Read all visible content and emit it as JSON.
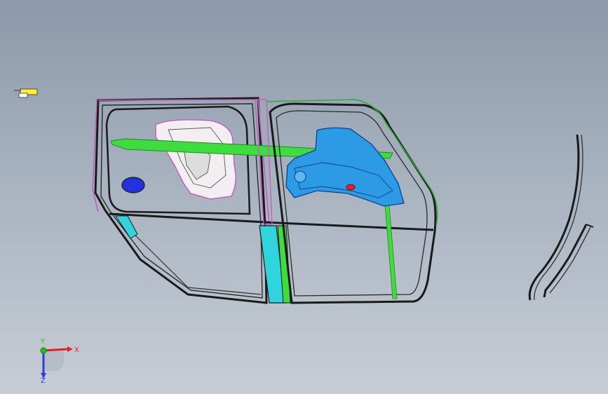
{
  "viewport": {
    "background_top": "#8c99aa",
    "background_bottom": "#c7cdd5"
  },
  "model": {
    "parts": [
      {
        "name": "front-door-frame",
        "color": "#1a1a1a"
      },
      {
        "name": "rear-door-frame",
        "color": "#1a1a1a"
      },
      {
        "name": "front-window-trim",
        "color": "#c060c0"
      },
      {
        "name": "rear-top-trim",
        "color": "#2fae2f"
      },
      {
        "name": "waist-belt-rail",
        "color": "#3fdc3f"
      },
      {
        "name": "front-inner-module",
        "color": "#f2eef2"
      },
      {
        "name": "rear-inner-module",
        "color": "#2d9ae6"
      },
      {
        "name": "center-pillar-lower",
        "color": "#2fd4dc"
      },
      {
        "name": "front-lower-pillar",
        "color": "#2fd4dc"
      },
      {
        "name": "speaker-hole",
        "color": "#2233dd"
      },
      {
        "name": "rear-guide-rail",
        "color": "#3fdc3f"
      },
      {
        "name": "glass-run-channel",
        "color": "#1a1a1a"
      }
    ]
  },
  "triad": {
    "x_label": "X",
    "y_label": "Y",
    "z_label": "Z",
    "x_color": "#e22222",
    "y_color": "#22c022",
    "z_color": "#2a3fd6"
  },
  "mini_icon": {
    "color": "#ffee33"
  }
}
